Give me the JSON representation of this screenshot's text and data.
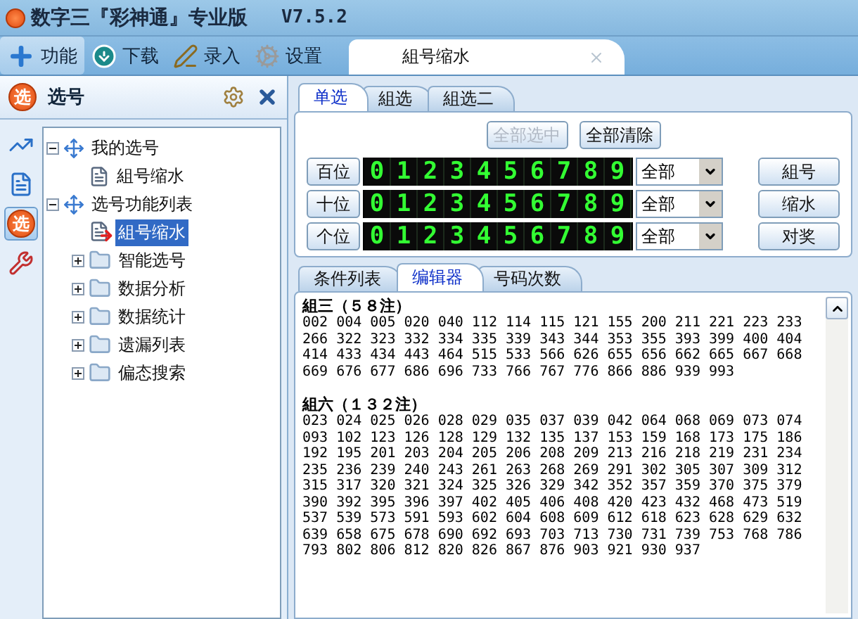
{
  "window": {
    "title": "数字三『彩神通』专业版",
    "version": "V7.5.2"
  },
  "toolbar": [
    {
      "label": "功能",
      "kind": "plus",
      "selected": true
    },
    {
      "label": "下载",
      "kind": "download",
      "selected": false
    },
    {
      "label": "录入",
      "kind": "pen",
      "selected": false
    },
    {
      "label": "设置",
      "kind": "gears",
      "selected": false
    }
  ],
  "doc_tab": {
    "label": "組号缩水"
  },
  "left_panel": {
    "icon_glyph": "选",
    "title": "选号"
  },
  "side_tabs": [
    {
      "kind": "chart",
      "selected": false
    },
    {
      "kind": "doc",
      "selected": false
    },
    {
      "kind": "glyph",
      "glyph": "选",
      "selected": true
    },
    {
      "kind": "tools",
      "selected": false
    }
  ],
  "tree": [
    {
      "label": "我的选号",
      "kind": "group",
      "expanded": true,
      "selected": false,
      "children": [
        {
          "label": "組号缩水",
          "kind": "doc",
          "selected": false
        }
      ]
    },
    {
      "label": "选号功能列表",
      "kind": "group",
      "expanded": true,
      "selected": false,
      "children": [
        {
          "label": "組号缩水",
          "kind": "run",
          "selected": true
        },
        {
          "label": "智能选号",
          "kind": "folder",
          "expanded": false,
          "selected": false
        },
        {
          "label": "数据分析",
          "kind": "folder",
          "expanded": false,
          "selected": false
        },
        {
          "label": "数据统计",
          "kind": "folder",
          "expanded": false,
          "selected": false
        },
        {
          "label": "遗漏列表",
          "kind": "folder",
          "expanded": false,
          "selected": false
        },
        {
          "label": "偏态搜索",
          "kind": "folder",
          "expanded": false,
          "selected": false
        }
      ]
    }
  ],
  "top_tabs": [
    {
      "label": "单选",
      "selected": true
    },
    {
      "label": "組选",
      "selected": false
    },
    {
      "label": "組选二",
      "selected": false
    }
  ],
  "top_buttons": [
    {
      "label": "全部选中",
      "disabled": true
    },
    {
      "label": "全部清除",
      "disabled": false
    }
  ],
  "digit_rows": [
    {
      "position": "百位",
      "filter": "全部",
      "action": "組号",
      "digits": [
        {
          "d": "0",
          "selected": true
        },
        {
          "d": "1",
          "selected": true
        },
        {
          "d": "2",
          "selected": true
        },
        {
          "d": "3",
          "selected": true
        },
        {
          "d": "4",
          "selected": true
        },
        {
          "d": "5",
          "selected": true
        },
        {
          "d": "6",
          "selected": true
        },
        {
          "d": "7",
          "selected": true
        },
        {
          "d": "8",
          "selected": true
        },
        {
          "d": "9",
          "selected": true
        }
      ]
    },
    {
      "position": "十位",
      "filter": "全部",
      "action": "缩水",
      "digits": [
        {
          "d": "0",
          "selected": true
        },
        {
          "d": "1",
          "selected": true
        },
        {
          "d": "2",
          "selected": true
        },
        {
          "d": "3",
          "selected": true
        },
        {
          "d": "4",
          "selected": true
        },
        {
          "d": "5",
          "selected": true
        },
        {
          "d": "6",
          "selected": true
        },
        {
          "d": "7",
          "selected": true
        },
        {
          "d": "8",
          "selected": true
        },
        {
          "d": "9",
          "selected": true
        }
      ]
    },
    {
      "position": "个位",
      "filter": "全部",
      "action": "对奖",
      "digits": [
        {
          "d": "0",
          "selected": true
        },
        {
          "d": "1",
          "selected": true
        },
        {
          "d": "2",
          "selected": true
        },
        {
          "d": "3",
          "selected": true
        },
        {
          "d": "4",
          "selected": true
        },
        {
          "d": "5",
          "selected": true
        },
        {
          "d": "6",
          "selected": true
        },
        {
          "d": "7",
          "selected": true
        },
        {
          "d": "8",
          "selected": true
        },
        {
          "d": "9",
          "selected": true
        }
      ]
    }
  ],
  "bottom_tabs": [
    {
      "label": "条件列表",
      "selected": false
    },
    {
      "label": "编辑器",
      "selected": true
    },
    {
      "label": "号码次数",
      "selected": false
    }
  ],
  "editor": [
    {
      "heading": "組三（５８注）",
      "lines": [
        "002 004 005 020 040 112 114 115 121 155 200 211 221 223 233",
        "266 322 323 332 334 335 339 343 344 353 355 393 399 400 404",
        "414 433 434 443 464 515 533 566 626 655 656 662 665 667 668",
        "669 676 677 686 696 733 766 767 776 866 886 939 993"
      ]
    },
    {
      "heading": "組六（１３２注）",
      "lines": [
        "023 024 025 026 028 029 035 037 039 042 064 068 069 073 074",
        "093 102 123 126 128 129 132 135 137 153 159 168 173 175 186",
        "192 195 201 203 204 205 206 208 209 213 216 218 219 231 234",
        "235 236 239 240 243 261 263 268 269 291 302 305 307 309 312",
        "315 317 320 321 324 325 326 329 342 352 357 359 370 375 379",
        "390 392 395 396 397 402 405 406 408 420 423 432 468 473 519",
        "537 539 573 591 593 602 604 608 609 612 618 623 628 629 632",
        "639 658 675 678 690 692 693 703 713 730 731 739 753 768 786",
        "793 802 806 812 820 826 867 876 903 921 930 937"
      ]
    }
  ]
}
